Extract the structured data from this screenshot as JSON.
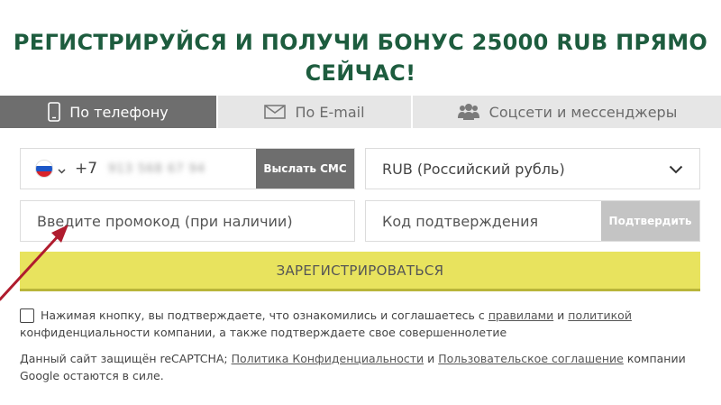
{
  "headline": {
    "line1": "РЕГИСТРИРУЙСЯ И ПОЛУЧИ БОНУС 25000 RUB ПРЯМО",
    "line2": "СЕЙЧАС!"
  },
  "tabs": [
    {
      "label": "По телефону",
      "icon": "phone-icon",
      "active": true
    },
    {
      "label": "По E-mail",
      "icon": "envelope-icon",
      "active": false
    },
    {
      "label": "Соцсети и мессенджеры",
      "icon": "users-icon",
      "active": false
    }
  ],
  "phone": {
    "country_flag": "russia-flag-icon",
    "code": "+7",
    "number": "913 568 67 94",
    "send_sms_label": "Выслать СМС"
  },
  "currency": {
    "selected": "RUB (Российский рубль)"
  },
  "promo": {
    "placeholder": "Введите промокод (при наличии)"
  },
  "confirmation": {
    "placeholder": "Код подтверждения",
    "confirm_label": "Подтвердить"
  },
  "register_label": "ЗАРЕГИСТРИРОВАТЬСЯ",
  "consent": {
    "text_before": "Нажимая кнопку, вы подтверждаете, что ознакомились и соглашаетесь с ",
    "rules_link": "правилами",
    "and": " и ",
    "policy_link": "политикой",
    "text_after": "конфиденциальности компании, а также подтверждаете свое совершеннолетие"
  },
  "recaptcha": {
    "text_before": "Данный сайт защищён reCAPTCHA; ",
    "privacy_link": "Политика Конфиденциальности",
    "and": " и ",
    "terms_link": "Пользовательское соглашение",
    "text_after": " компании Google остаются в силе."
  },
  "colors": {
    "headline": "#1d5c3e",
    "register_button": "#e8e35e",
    "active_tab": "#6e6e6e",
    "arrow": "#b01c2e"
  }
}
